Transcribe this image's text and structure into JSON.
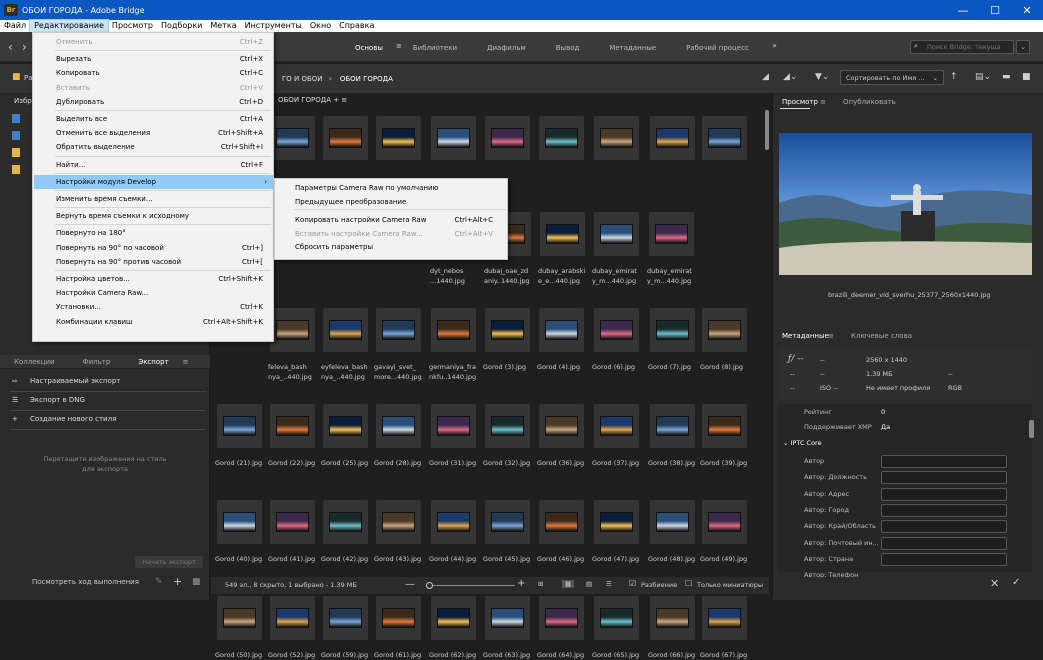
{
  "window": {
    "title": "ОБОИ ГОРОДА - Adobe Bridge",
    "logo": "Br",
    "controls": [
      "—",
      "☐",
      "✕"
    ]
  },
  "menubar": [
    "Файл",
    "Редактирование",
    "Просмотр",
    "Подборки",
    "Метка",
    "Инструменты",
    "Окно",
    "Справка"
  ],
  "workspaces": {
    "items": [
      "Основы",
      "Библиотеки",
      "Диафильм",
      "Вывод",
      "Метаданные",
      "Рабочий процесс"
    ],
    "current": "Основы"
  },
  "search": {
    "placeholder": "Поиск Bridge: текуща"
  },
  "breadcrumb": {
    "parent": "ГО И ОБОИ",
    "current": "ОБОИ ГОРОДА"
  },
  "sort": {
    "label": "Сортировать по Имя ..."
  },
  "content_tab": "ОБОИ ГОРОДА",
  "left_panel": {
    "tabs": [
      "Коллекции",
      "Фильтр",
      "Экспорт"
    ],
    "current_tab": "Экспорт",
    "export_items": [
      "Настраиваемый экспорт",
      "Экспорт в DNG",
      "Создание нового стиля"
    ],
    "drop_hint": "Перетащите изображения на стиль для экспорта",
    "start_export": "Начать экспорт",
    "progress": "Посмотреть ход выполнения",
    "hidden_tab_prefix": "Избр"
  },
  "edit_menu": [
    {
      "label": "Отменить",
      "shortcut": "Ctrl+Z",
      "disabled": true
    },
    {
      "sep": true
    },
    {
      "label": "Вырезать",
      "shortcut": "Ctrl+X"
    },
    {
      "label": "Копировать",
      "shortcut": "Ctrl+C"
    },
    {
      "label": "Вставить",
      "shortcut": "Ctrl+V",
      "disabled": true
    },
    {
      "label": "Дублировать",
      "shortcut": "Ctrl+D"
    },
    {
      "sep": true
    },
    {
      "label": "Выделить все",
      "shortcut": "Ctrl+A"
    },
    {
      "label": "Отменить все выделения",
      "shortcut": "Ctrl+Shift+A"
    },
    {
      "label": "Обратить выделение",
      "shortcut": "Ctrl+Shift+I"
    },
    {
      "sep": true
    },
    {
      "label": "Найти...",
      "shortcut": "Ctrl+F"
    },
    {
      "sep": true
    },
    {
      "label": "Настройки модуля Develop",
      "submenu": true,
      "highlighted": true
    },
    {
      "sep": true
    },
    {
      "label": "Изменить время съемки..."
    },
    {
      "sep": true
    },
    {
      "label": "Вернуть время съемки к исходному"
    },
    {
      "sep": true
    },
    {
      "label": "Повернуто на 180°"
    },
    {
      "label": "Повернуть на 90° по часовой",
      "shortcut": "Ctrl+]"
    },
    {
      "label": "Повернуть на 90° против часовой",
      "shortcut": "Ctrl+["
    },
    {
      "sep": true
    },
    {
      "label": "Настройка цветов...",
      "shortcut": "Ctrl+Shift+K"
    },
    {
      "label": "Настройки Camera Raw..."
    },
    {
      "label": "Установки...",
      "shortcut": "Ctrl+K"
    },
    {
      "label": "Комбинации клавиш",
      "shortcut": "Ctrl+Alt+Shift+K"
    }
  ],
  "develop_submenu": [
    {
      "label": "Параметры Camera Raw по умолчанию"
    },
    {
      "label": "Предыдущее преобразование"
    },
    {
      "sep": true
    },
    {
      "label": "Копировать настройки Camera Raw",
      "shortcut": "Ctrl+Alt+C"
    },
    {
      "label": "Вставить настройки Camera Raw...",
      "shortcut": "Ctrl+Alt+V",
      "disabled": true
    },
    {
      "label": "Сбросить параметры"
    }
  ],
  "thumbnails": [
    [
      "",
      "",
      "",
      "",
      "",
      "",
      "",
      "",
      "",
      ""
    ],
    [
      "",
      "",
      "",
      "",
      "",
      "",
      "dyt_nebos ...1440.jpg",
      "dubaj_oae_zd aniy..1440.jpg",
      "dubay_arabski e_e...440.jpg",
      "dubay_emirat y_m...440.jpg",
      "dubay_emirat y_m...440.jpg"
    ],
    [
      "",
      "feleva_bash nya_..440.jpg",
      "eyfeleva_bash nya_..440.jpg",
      "gavayi_svet_ more...440.jpg",
      "germaniya_fra nkfu..1440.jpg",
      "Gorod (3).jpg",
      "Gorod (4).jpg",
      "Gorod (6).jpg",
      "Gorod (7).jpg",
      "Gorod (8).jpg"
    ],
    [
      "Gorod (21).jpg",
      "Gorod (22).jpg",
      "Gorod (25).jpg",
      "Gorod (28).jpg",
      "Gorod (31).jpg",
      "Gorod (32).jpg",
      "Gorod (36).jpg",
      "Gorod (37).jpg",
      "Gorod (38).jpg",
      "Gorod (39).jpg"
    ],
    [
      "Gorod (40).jpg",
      "Gorod (41).jpg",
      "Gorod (42).jpg",
      "Gorod (43).jpg",
      "Gorod (44).jpg",
      "Gorod (45).jpg",
      "Gorod (46).jpg",
      "Gorod (47).jpg",
      "Gorod (48).jpg",
      "Gorod (49).jpg"
    ],
    [
      "Gorod (50).jpg",
      "Gorod (52).jpg",
      "Gorod (59).jpg",
      "Gorod (61).jpg",
      "Gorod (62).jpg",
      "Gorod (63).jpg",
      "Gorod (64).jpg",
      "Gorod (65).jpg",
      "Gorod (66).jpg",
      "Gorod (67).jpg"
    ]
  ],
  "status": {
    "text": "549 эл., 8 скрыто, 1 выбрано - 1.39 МБ",
    "split": "Разбиение",
    "thumbs_only": "Только миниатюры"
  },
  "right_panel": {
    "tabs_top": [
      "Просмотр",
      "Опубликовать"
    ],
    "preview_caption": "brazili_deemer_vid_sverhu_25377_2560x1440.jpg",
    "tabs_meta": [
      "Метаданные",
      "Ключевые слова"
    ],
    "meta": {
      "f": "ƒ/ --",
      "exposure": "--",
      "dims": "2560 x 1440",
      "size": "1.39 МБ",
      "iso": "ISO --",
      "profile": "Не имеет профиля",
      "mode": "RGB",
      "r1": "--",
      "r2": "--",
      "r3": "--",
      "r4": "--"
    },
    "rows": [
      {
        "k": "Рейтинг",
        "v": "0"
      },
      {
        "k": "Поддерживает XMP",
        "v": "Да"
      }
    ],
    "iptc": "IPTC Core",
    "iptc_fields": [
      "Автор",
      "Автор: Должность",
      "Автор: Адрес",
      "Автор: Город",
      "Автор: Край/Область",
      "Автор: Почтовый ин...",
      "Автор: Страна",
      "Автор: Телефон"
    ]
  }
}
